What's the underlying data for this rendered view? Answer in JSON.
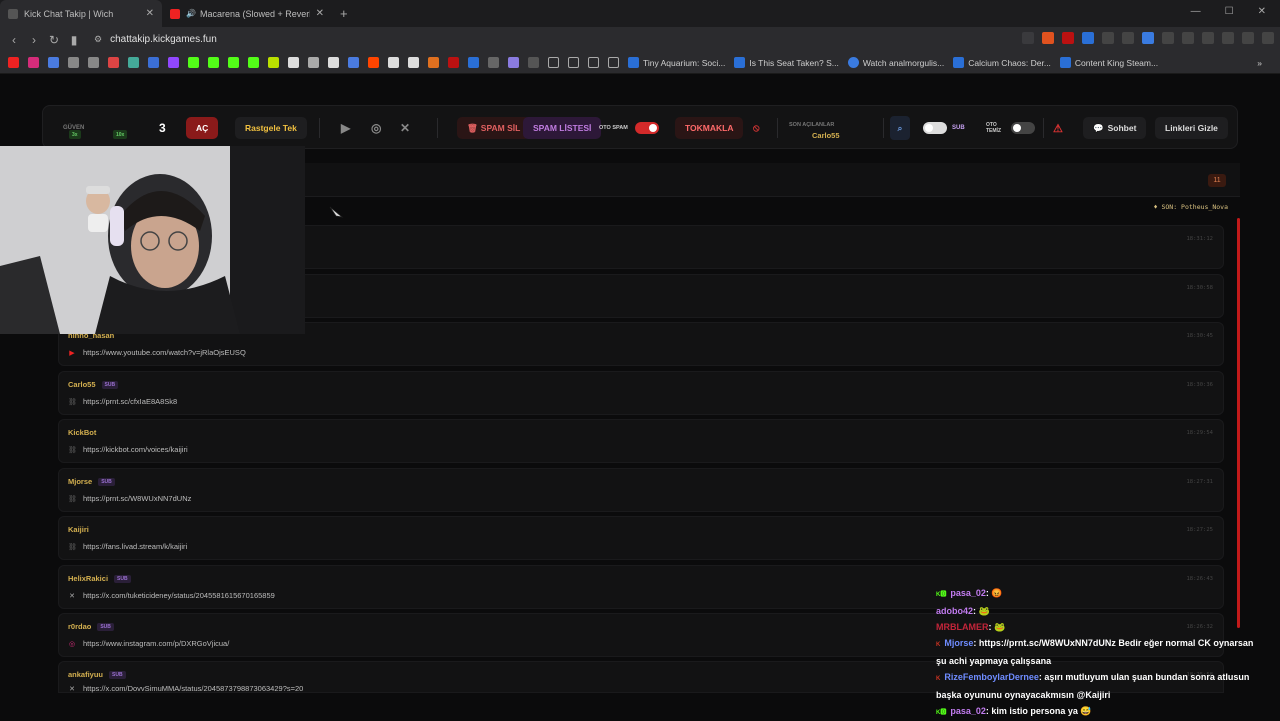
{
  "browser": {
    "tabs": [
      {
        "title": "Kick Chat Takip | Wich",
        "active": true,
        "favcolor": "#3b3b3d"
      },
      {
        "title": "Macarena (Slowed + Reverb) | G...",
        "active": false,
        "favcolor": "#e22"
      }
    ],
    "url": "chattakip.kickgames.fun",
    "bookmarks": [
      "Tiny Aquarium: Soci...",
      "Is This Seat Taken? S...",
      "Watch analmorgulis...",
      "Calcium Chaos: Der...",
      "Content King Steam..."
    ]
  },
  "toolbar": {
    "guvenlik": "GÜVEN",
    "mult_3x": "3x",
    "mult_10x": "10x",
    "count": "3",
    "ac_label": "AÇ",
    "random_label": "Rastgele Tek",
    "spam_delete": "SPAM SİL",
    "spam_list": "SPAM LİSTESİ",
    "auto_spam": "OTO SPAM",
    "tokmakla": "TOKMAKLA",
    "last_opened_title": "SON AÇILANLAR",
    "last_opened_user": "Carlo55",
    "sub_label": "SUB",
    "auto_clean": "OTO TEMİZ",
    "sohbet": "Sohbet",
    "hide_links": "Linkleri Gizle"
  },
  "header": {
    "count_badge": "11",
    "top_info": "SON: Potheus_Nova"
  },
  "messages": [
    {
      "user": "",
      "sub": false,
      "icon": "",
      "link": "",
      "time": "18:31:12"
    },
    {
      "user": "",
      "sub": false,
      "icon": "",
      "link": "",
      "time": "18:30:58"
    },
    {
      "user": "ninno_hasan",
      "sub": false,
      "icon": "youtube",
      "link": "https://www.youtube.com/watch?v=jRlaOjsEUSQ",
      "time": "18:30:45"
    },
    {
      "user": "Carlo55",
      "sub": true,
      "icon": "chain",
      "link": "https://prnt.sc/cfxIaE8A8Sk8",
      "time": "18:30:36"
    },
    {
      "user": "KickBot",
      "sub": false,
      "icon": "chain",
      "link": "https://kickbot.com/voices/kaijiri",
      "time": "18:29:54"
    },
    {
      "user": "Mjorse",
      "sub": true,
      "icon": "chain",
      "link": "https://prnt.sc/W8WUxNN7dUNz",
      "time": "18:27:31"
    },
    {
      "user": "Kaijiri",
      "sub": false,
      "icon": "chain",
      "link": "https://fans.livad.stream/k/kaijiri",
      "time": "18:27:25"
    },
    {
      "user": "HelixRakici",
      "sub": true,
      "icon": "x",
      "link": "https://x.com/tuketicideney/status/2045581615670165859",
      "time": "18:26:43"
    },
    {
      "user": "r0rdao",
      "sub": true,
      "icon": "instagram",
      "link": "https://www.instagram.com/p/DXRGoVjicua/",
      "time": "18:26:32"
    },
    {
      "user": "ankafiyuu",
      "sub": true,
      "icon": "x",
      "link": "https://x.com/DovvSimuMMA/status/2045873798873063429?s=20",
      "time": "18:25:58"
    }
  ],
  "stream_chat": [
    {
      "prefix": "K🅾",
      "user": "pasa_02",
      "ucolor": "#c27cf0",
      "text": ": 😡"
    },
    {
      "prefix": "",
      "user": "adobo42",
      "ucolor": "#c27cf0",
      "text": ": 🐸"
    },
    {
      "prefix": "",
      "user": "MRBLAMER",
      "ucolor": "#c3253a",
      "text": ": 🐸"
    },
    {
      "prefix": "K",
      "user": "Mjorse",
      "ucolor": "#6f8cff",
      "text": ": https://prnt.sc/W8WUxNN7dUNz Bedir eğer normal CK oynarsan"
    },
    {
      "prefix": "",
      "user": "",
      "ucolor": "#fff",
      "text": "şu achi yapmaya çalışsana"
    },
    {
      "prefix": "K",
      "user": "RizeFemboylarDernee",
      "ucolor": "#6f8cff",
      "text": ": aşırı mutluyum ulan şuan bundan sonra atlusun"
    },
    {
      "prefix": "",
      "user": "",
      "ucolor": "#fff",
      "text": "başka oyununu oynayacakmısın @Kaijiri"
    },
    {
      "prefix": "K🅾",
      "user": "pasa_02",
      "ucolor": "#c27cf0",
      "text": ": kim istio persona ya 😅"
    }
  ]
}
